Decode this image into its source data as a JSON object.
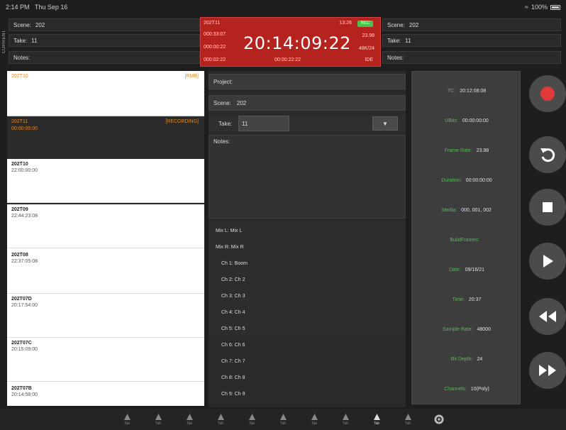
{
  "status": {
    "time": "2:14 PM",
    "date": "Thu Sep 16",
    "battery": "100%"
  },
  "header": {
    "side_tab": "CURRENT",
    "left": {
      "scene_label": "Scene:",
      "scene_value": "202",
      "take_label": "Take:",
      "take_value": "11",
      "notes_label": "Notes:"
    },
    "right": {
      "scene_label": "Scene:",
      "scene_value": "202",
      "take_label": "Take:",
      "take_value": "11",
      "notes_label": "Notes:"
    },
    "timecode": {
      "main": "20:14:09:22",
      "top_left": "202T11",
      "row2_left": "000:33:07",
      "row3_left": "000:00:22",
      "row4_left": "000:02:22",
      "top_right": "13:26",
      "rec_badge": "REC",
      "row2_right": "23.98",
      "row3_right": "48K/24",
      "bottom_center": "00:00:22:22",
      "bottom_right": "IDE"
    }
  },
  "left_list": {
    "top_left": "202T10",
    "top_right": "[RMB]",
    "dark_left_1": "202T11",
    "dark_left_2": "00:00:00:00",
    "dark_right": "[RECORDING]",
    "clips": [
      {
        "name": "202T10",
        "time": "22:00:00:00"
      },
      {
        "name": "202T09",
        "time": "22:44:23:08"
      },
      {
        "name": "202T08",
        "time": "22:37:05:08"
      },
      {
        "name": "202T07D",
        "time": "20:17:54:00"
      },
      {
        "name": "202T07C",
        "time": "20:15:09:00"
      },
      {
        "name": "202T07B",
        "time": "20:14:58:00"
      }
    ]
  },
  "middle": {
    "project_label": "Project:",
    "scene_label": "Scene:",
    "scene_value": "202",
    "take_label": "Take:",
    "take_value": "11",
    "take_button": "▼",
    "notes_label": "Notes:",
    "channels": [
      "Mix L: Mix L",
      "Mix R: Mix R",
      "Ch 1: Boom",
      "Ch 2: Ch 2",
      "Ch 3: Ch 3",
      "Ch 4: Ch 4",
      "Ch 5: Ch 5",
      "Ch 6: Ch 6",
      "Ch 7: Ch 7",
      "Ch 8: Ch 8",
      "Ch 9: Ch 9"
    ]
  },
  "info": {
    "rows": [
      {
        "k": "TC:",
        "v": "20:12:08:08"
      },
      {
        "k": "UBits:",
        "v": "00:00:00:00"
      },
      {
        "k": "Frame Rate:",
        "v": "23.98"
      },
      {
        "k": "Duration:",
        "v": "00:00:00:00"
      },
      {
        "k": "Media:",
        "v": "000, 001, 002"
      },
      {
        "k": "BuildFrames:",
        "v": ""
      },
      {
        "k": "Date:",
        "v": "09/16/21"
      },
      {
        "k": "Time:",
        "v": "20:37"
      },
      {
        "k": "Sample Rate:",
        "v": "48000"
      },
      {
        "k": "Bit Depth:",
        "v": "24"
      },
      {
        "k": "Channels:",
        "v": "10(Poly)"
      }
    ]
  },
  "transport": {
    "record": "record-icon",
    "undo": "undo-icon",
    "stop": "stop-icon",
    "play": "play-icon",
    "rewind": "rewind-icon",
    "forward": "fast-forward-icon"
  },
  "toolbar": {
    "items": [
      "Tab",
      "Tab",
      "Tab",
      "Tab",
      "Tab",
      "Tab",
      "Tab",
      "Tab",
      "Tab",
      "Tab",
      "Tab"
    ],
    "active": 8,
    "settings": "gear-icon"
  }
}
